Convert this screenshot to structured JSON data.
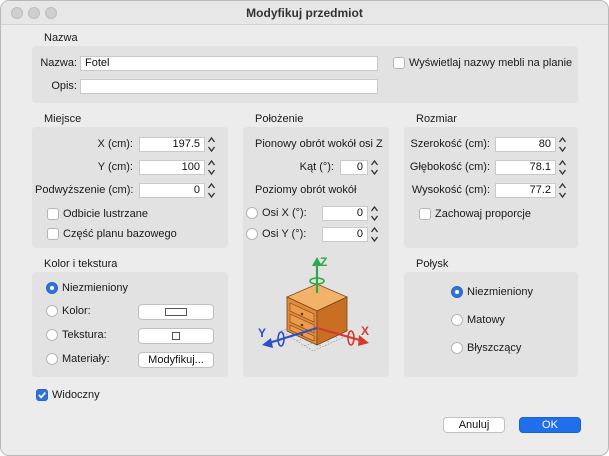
{
  "window": {
    "title": "Modyfikuj przedmiot"
  },
  "name_section": {
    "title": "Nazwa",
    "name_label": "Nazwa:",
    "name_value": "Fotel",
    "description_label": "Opis:",
    "description_value": "",
    "show_names_label": "Wyświetlaj nazwy mebli na planie",
    "show_names_checked": false
  },
  "location": {
    "title": "Miejsce",
    "x_label": "X (cm):",
    "x_value": "197.5",
    "y_label": "Y (cm):",
    "y_value": "100",
    "elevation_label": "Podwyższenie (cm):",
    "elevation_value": "0",
    "mirror_label": "Odbicie lustrzane",
    "mirror_checked": false,
    "base_plan_label": "Część planu bazowego",
    "base_plan_checked": false
  },
  "orientation": {
    "title": "Położenie",
    "vertical_rotation_label": "Pionowy obrót wokół osi Z",
    "angle_label": "Kąt (°):",
    "angle_value": "0",
    "horizontal_rotation_label": "Poziomy obrót wokół",
    "axis_x_label": "Osi X (°):",
    "axis_x_value": "0",
    "axis_y_label": "Osi Y (°):",
    "axis_y_value": "0",
    "axis_z_letter": "Z",
    "axis_x_letter": "X",
    "axis_y_letter": "Y"
  },
  "size": {
    "title": "Rozmiar",
    "width_label": "Szerokość (cm):",
    "width_value": "80",
    "depth_label": "Głębokość (cm):",
    "depth_value": "78.1",
    "height_label": "Wysokość (cm):",
    "height_value": "77.2",
    "keep_proportions_label": "Zachowaj proporcje",
    "keep_proportions_checked": false
  },
  "color_texture": {
    "title": "Kolor i tekstura",
    "unchanged_label": "Niezmieniony",
    "color_label": "Kolor:",
    "texture_label": "Tekstura:",
    "materials_label": "Materiały:",
    "modify_button": "Modyfikuj...",
    "selected": "unchanged"
  },
  "shininess": {
    "title": "Połysk",
    "unchanged_label": "Niezmieniony",
    "matte_label": "Matowy",
    "shiny_label": "Błyszczący",
    "selected": "unchanged"
  },
  "visible": {
    "label": "Widoczny",
    "checked": true
  },
  "buttons": {
    "cancel": "Anuluj",
    "ok": "OK"
  },
  "colors": {
    "accent": "#2f73d9",
    "ok_button": "#1f6fea",
    "furniture": "#e08a3c",
    "axis_x": "#d63a2f",
    "axis_y": "#2a4fc9",
    "axis_z": "#2fa84a"
  }
}
